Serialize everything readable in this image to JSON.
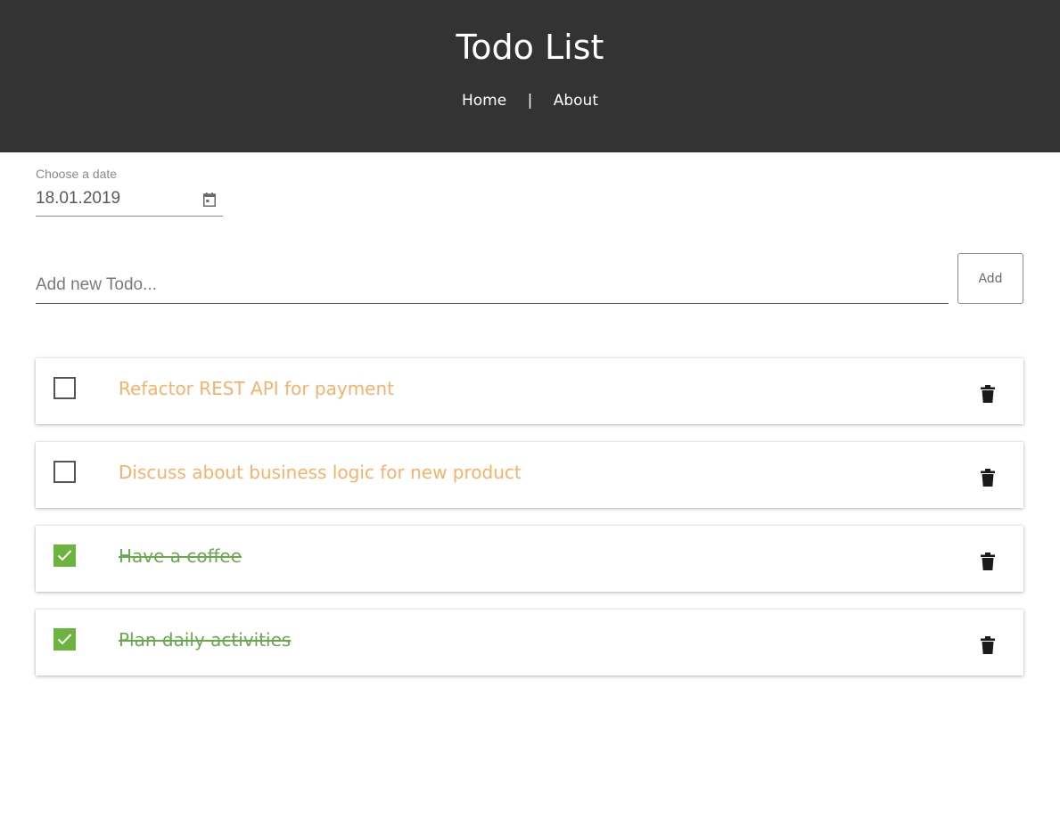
{
  "header": {
    "title": "Todo List",
    "nav": {
      "home": "Home",
      "separator": "|",
      "about": "About"
    }
  },
  "date_picker": {
    "label": "Choose a date",
    "value": "18.01.2019",
    "icon": "calendar-icon"
  },
  "new_todo": {
    "placeholder": "Add new Todo...",
    "value": "",
    "add_label": "Add"
  },
  "todos": [
    {
      "text": "Refactor REST API for payment",
      "completed": false
    },
    {
      "text": "Discuss about business logic for new product",
      "completed": false
    },
    {
      "text": "Have a coffee",
      "completed": true
    },
    {
      "text": "Plan daily activities",
      "completed": true
    }
  ],
  "colors": {
    "header_bg": "#333333",
    "pending_text": "#f6b26b",
    "done_text": "#6aa84f",
    "checkbox_checked": "#6cb33f"
  },
  "icons": {
    "delete": "trash-icon",
    "check": "check-icon"
  }
}
